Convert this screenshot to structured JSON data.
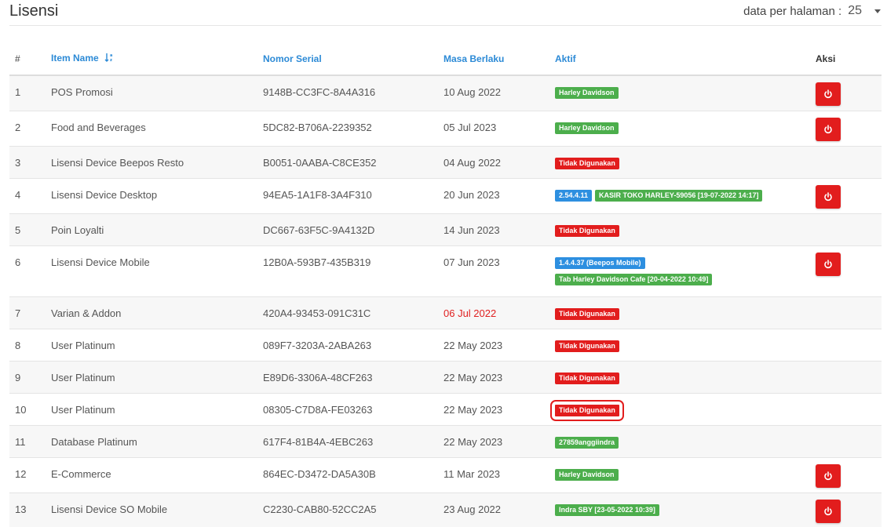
{
  "page": {
    "title": "Lisensi",
    "per_page_label": "data per halaman :",
    "per_page_value": "25"
  },
  "table": {
    "headers": {
      "no": "#",
      "item_name": "Item Name",
      "serial": "Nomor Serial",
      "expiry": "Masa Berlaku",
      "active": "Aktif",
      "action": "Aksi"
    },
    "colors": {
      "accent": "#2c8ad6",
      "green_badge": "#4cae4c",
      "red_badge": "#e21d1d",
      "blue_badge": "#2d8fe0"
    },
    "rows": [
      {
        "no": "1",
        "name": "POS Promosi",
        "serial": "9148B-CC3FC-8A4A316",
        "expiry": "10 Aug 2022",
        "expired": false,
        "badges": [
          [
            {
              "text": "Harley Davidson",
              "color": "green"
            }
          ]
        ],
        "action": true,
        "highlight": false
      },
      {
        "no": "2",
        "name": "Food and Beverages",
        "serial": "5DC82-B706A-2239352",
        "expiry": "05 Jul 2023",
        "expired": false,
        "badges": [
          [
            {
              "text": "Harley Davidson",
              "color": "green"
            }
          ]
        ],
        "action": true,
        "highlight": false
      },
      {
        "no": "3",
        "name": "Lisensi Device Beepos Resto",
        "serial": "B0051-0AABA-C8CE352",
        "expiry": "04 Aug 2022",
        "expired": false,
        "badges": [
          [
            {
              "text": "Tidak Digunakan",
              "color": "red"
            }
          ]
        ],
        "action": false,
        "highlight": false
      },
      {
        "no": "4",
        "name": "Lisensi Device Desktop",
        "serial": "94EA5-1A1F8-3A4F310",
        "expiry": "20 Jun 2023",
        "expired": false,
        "badges": [
          [
            {
              "text": "2.54.4.11",
              "color": "blue"
            },
            {
              "text": "KASIR TOKO HARLEY-59056 [19-07-2022 14:17]",
              "color": "green"
            }
          ]
        ],
        "action": true,
        "highlight": false
      },
      {
        "no": "5",
        "name": "Poin Loyalti",
        "serial": "DC667-63F5C-9A4132D",
        "expiry": "14 Jun 2023",
        "expired": false,
        "badges": [
          [
            {
              "text": "Tidak Digunakan",
              "color": "red"
            }
          ]
        ],
        "action": false,
        "highlight": false
      },
      {
        "no": "6",
        "name": "Lisensi Device Mobile",
        "serial": "12B0A-593B7-435B319",
        "expiry": "07 Jun 2023",
        "expired": false,
        "badges": [
          [
            {
              "text": "1.4.4.37 (Beepos Mobile)",
              "color": "blue"
            }
          ],
          [
            {
              "text": "Tab Harley Davidson Cafe [20-04-2022 10:49]",
              "color": "green"
            }
          ]
        ],
        "action": true,
        "highlight": false
      },
      {
        "no": "7",
        "name": "Varian & Addon",
        "serial": "420A4-93453-091C31C",
        "expiry": "06 Jul 2022",
        "expired": true,
        "badges": [
          [
            {
              "text": "Tidak Digunakan",
              "color": "red"
            }
          ]
        ],
        "action": false,
        "highlight": false
      },
      {
        "no": "8",
        "name": "User Platinum",
        "serial": "089F7-3203A-2ABA263",
        "expiry": "22 May 2023",
        "expired": false,
        "badges": [
          [
            {
              "text": "Tidak Digunakan",
              "color": "red"
            }
          ]
        ],
        "action": false,
        "highlight": false
      },
      {
        "no": "9",
        "name": "User Platinum",
        "serial": "E89D6-3306A-48CF263",
        "expiry": "22 May 2023",
        "expired": false,
        "badges": [
          [
            {
              "text": "Tidak Digunakan",
              "color": "red"
            }
          ]
        ],
        "action": false,
        "highlight": false
      },
      {
        "no": "10",
        "name": "User Platinum",
        "serial": "08305-C7D8A-FE03263",
        "expiry": "22 May 2023",
        "expired": false,
        "badges": [
          [
            {
              "text": "Tidak Digunakan",
              "color": "red"
            }
          ]
        ],
        "action": false,
        "highlight": true
      },
      {
        "no": "11",
        "name": "Database Platinum",
        "serial": "617F4-81B4A-4EBC263",
        "expiry": "22 May 2023",
        "expired": false,
        "badges": [
          [
            {
              "text": "27859anggiindra",
              "color": "green"
            }
          ]
        ],
        "action": false,
        "highlight": false
      },
      {
        "no": "12",
        "name": "E-Commerce",
        "serial": "864EC-D3472-DA5A30B",
        "expiry": "11 Mar 2023",
        "expired": false,
        "badges": [
          [
            {
              "text": "Harley Davidson",
              "color": "green"
            }
          ]
        ],
        "action": true,
        "highlight": false
      },
      {
        "no": "13",
        "name": "Lisensi Device SO Mobile",
        "serial": "C2230-CAB80-52CC2A5",
        "expiry": "23 Aug 2022",
        "expired": false,
        "badges": [
          [
            {
              "text": "Indra SBY [23-05-2022 10:39]",
              "color": "green"
            }
          ]
        ],
        "action": true,
        "highlight": false
      }
    ]
  }
}
